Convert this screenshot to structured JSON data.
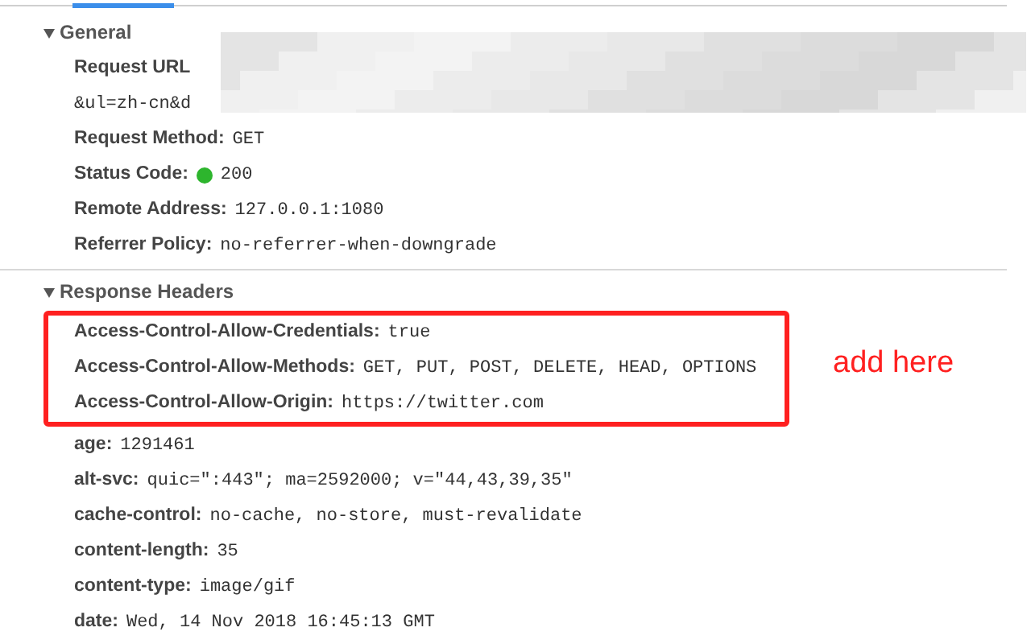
{
  "sections": [
    {
      "title": "General",
      "expanded": true,
      "rows": [
        {
          "name": "Request URL",
          "value": "",
          "redacted": true
        },
        {
          "name": "",
          "value": "&ul=zh-cn&d"
        },
        {
          "name": "Request Method:",
          "value": "GET"
        },
        {
          "name": "Status Code:",
          "value": "200",
          "color": "#2db52d"
        },
        {
          "name": "Remote Address:",
          "value": "127.0.0.1:1080"
        },
        {
          "name": "Referrer Policy:",
          "value": "no-referrer-when-downgrade"
        }
      ]
    },
    {
      "title": "Response Headers",
      "expanded": true,
      "rows": [
        {
          "name": "Access-Control-Allow-Credentials:",
          "value": "true",
          "highlighted": true
        },
        {
          "name": "Access-Control-Allow-Methods:",
          "value": "GET, PUT, POST, DELETE, HEAD, OPTIONS",
          "highlighted": true
        },
        {
          "name": "Access-Control-Allow-Origin:",
          "value": "https://twitter.com",
          "highlighted": true
        },
        {
          "name": "age:",
          "value": "1291461"
        },
        {
          "name": "alt-svc:",
          "value": "quic=\":443\"; ma=2592000; v=\"44,43,39,35\""
        },
        {
          "name": "cache-control:",
          "value": "no-cache, no-store, must-revalidate"
        },
        {
          "name": "content-length:",
          "value": "35"
        },
        {
          "name": "content-type:",
          "value": "image/gif"
        },
        {
          "name": "date:",
          "value": "Wed, 14 Nov 2018 16:45:13 GMT"
        }
      ]
    }
  ],
  "annotation": {
    "text": "add here"
  }
}
